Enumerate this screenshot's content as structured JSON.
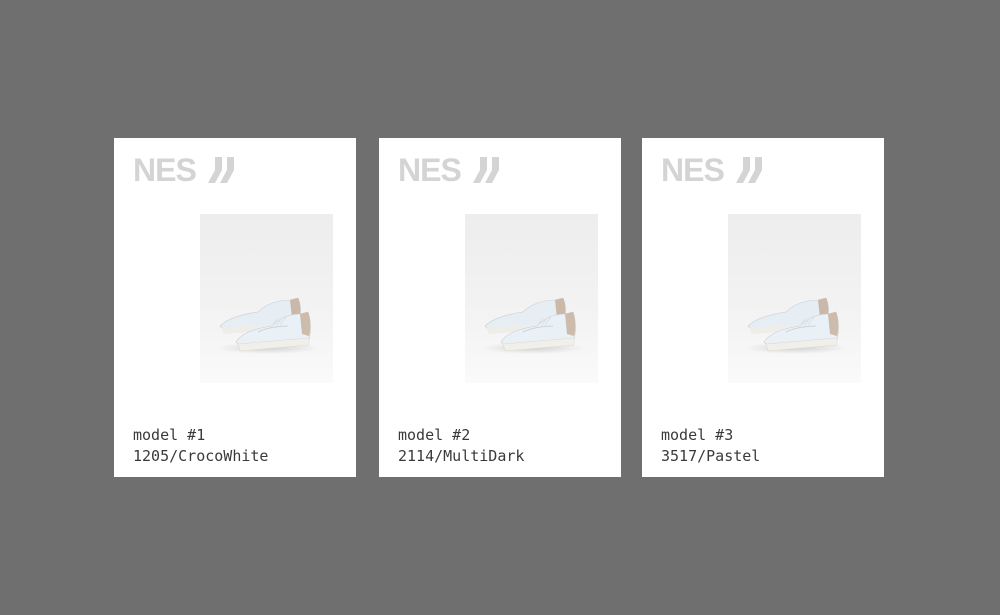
{
  "brand": {
    "name": "NES",
    "mark_icon": "double-slash-logo-icon",
    "color": "#d4d4d4"
  },
  "background_color": "#6f6f6f",
  "cards": [
    {
      "model": "model #1",
      "variant": "1205/CrocoWhite",
      "image": "white-sneakers-photo"
    },
    {
      "model": "model #2",
      "variant": "2114/MultiDark",
      "image": "white-sneakers-photo"
    },
    {
      "model": "model #3",
      "variant": "3517/Pastel",
      "image": "white-sneakers-photo"
    }
  ]
}
